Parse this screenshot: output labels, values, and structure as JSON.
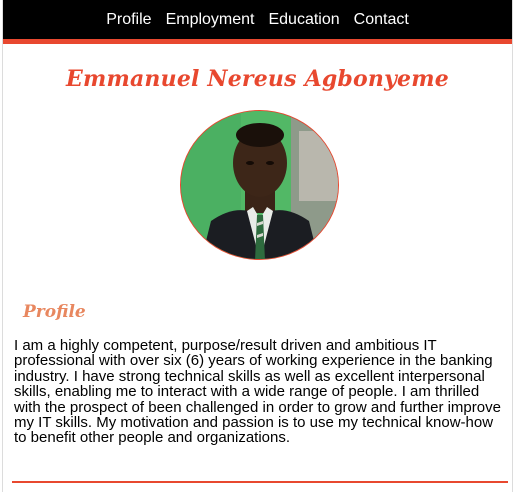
{
  "nav": {
    "items": [
      {
        "label": "Profile"
      },
      {
        "label": "Employment"
      },
      {
        "label": "Education"
      },
      {
        "label": "Contact"
      }
    ]
  },
  "header": {
    "name": "Emmanuel Nereus Agbonyeme"
  },
  "avatar": {
    "alt": "profile-photo"
  },
  "profile": {
    "heading": "Profile",
    "text": "I am a highly competent, purpose/result driven and ambitious IT professional with over six (6) years of working experience in the banking industry. I have strong technical skills as well as excellent interpersonal skills, enabling me to interact with a wide range of people. I am thrilled with the prospect of been challenged in order to grow and further improve my IT skills. My motivation and passion is to use my technical know-how to benefit other people and organizations."
  },
  "colors": {
    "accent": "#e8482f",
    "heading_soft": "#e8875f",
    "nav_background": "#000000",
    "nav_text": "#ffffff"
  }
}
